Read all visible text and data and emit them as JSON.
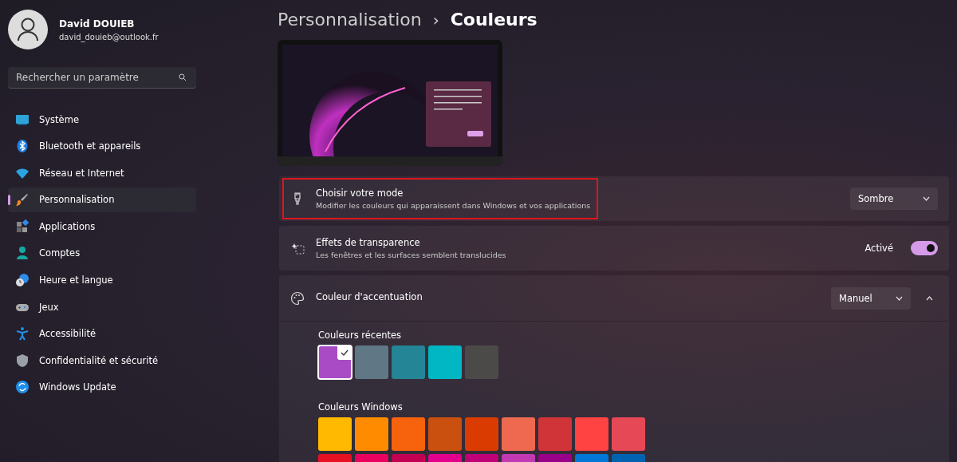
{
  "user": {
    "name": "David DOUIEB",
    "email": "david_douieb@outlook.fr"
  },
  "search": {
    "placeholder": "Rechercher un paramètre"
  },
  "nav": [
    {
      "label": "Système",
      "selected": false
    },
    {
      "label": "Bluetooth et appareils",
      "selected": false
    },
    {
      "label": "Réseau et Internet",
      "selected": false
    },
    {
      "label": "Personnalisation",
      "selected": true
    },
    {
      "label": "Applications",
      "selected": false
    },
    {
      "label": "Comptes",
      "selected": false
    },
    {
      "label": "Heure et langue",
      "selected": false
    },
    {
      "label": "Jeux",
      "selected": false
    },
    {
      "label": "Accessibilité",
      "selected": false
    },
    {
      "label": "Confidentialité et sécurité",
      "selected": false
    },
    {
      "label": "Windows Update",
      "selected": false
    }
  ],
  "breadcrumb": {
    "parent": "Personnalisation",
    "separator": "›",
    "current": "Couleurs"
  },
  "settings": [
    {
      "kind": "dropdown",
      "title": "Choisir votre mode",
      "description": "Modifier les couleurs qui apparaissent dans Windows et vos applications",
      "value": "Sombre",
      "highlighted": true
    },
    {
      "kind": "toggle",
      "title": "Effets de transparence",
      "description": "Les fenêtres et les surfaces semblent translucides",
      "state_label": "Activé",
      "on": true,
      "highlighted": false
    },
    {
      "kind": "expander",
      "title": "Couleur d'accentuation",
      "value": "Manuel",
      "expanded": true,
      "highlighted": false
    }
  ],
  "accent": {
    "recent_label": "Couleurs récentes",
    "recent": [
      {
        "color": "#a84bc4",
        "selected": true
      },
      {
        "color": "#607886",
        "selected": false
      },
      {
        "color": "#238596",
        "selected": false
      },
      {
        "color": "#00b7c3",
        "selected": false
      },
      {
        "color": "#4c4a48",
        "selected": false
      }
    ],
    "windows_label": "Couleurs Windows",
    "windows": [
      {
        "color": "#ffb900",
        "selected": false
      },
      {
        "color": "#ff8c00",
        "selected": false
      },
      {
        "color": "#f7630c",
        "selected": false
      },
      {
        "color": "#ca5010",
        "selected": false
      },
      {
        "color": "#da3b01",
        "selected": false
      },
      {
        "color": "#ef6950",
        "selected": false
      },
      {
        "color": "#d13438",
        "selected": false
      },
      {
        "color": "#ff4343",
        "selected": false
      },
      {
        "color": "#e74856",
        "selected": false
      },
      {
        "color": "#e81123",
        "selected": false
      },
      {
        "color": "#ea005e",
        "selected": false
      },
      {
        "color": "#c30052",
        "selected": false
      },
      {
        "color": "#e3008c",
        "selected": false
      },
      {
        "color": "#bf0077",
        "selected": false
      },
      {
        "color": "#c239b3",
        "selected": false
      },
      {
        "color": "#9a0089",
        "selected": false
      },
      {
        "color": "#0078d7",
        "selected": false
      },
      {
        "color": "#0063b1",
        "selected": false
      }
    ]
  }
}
